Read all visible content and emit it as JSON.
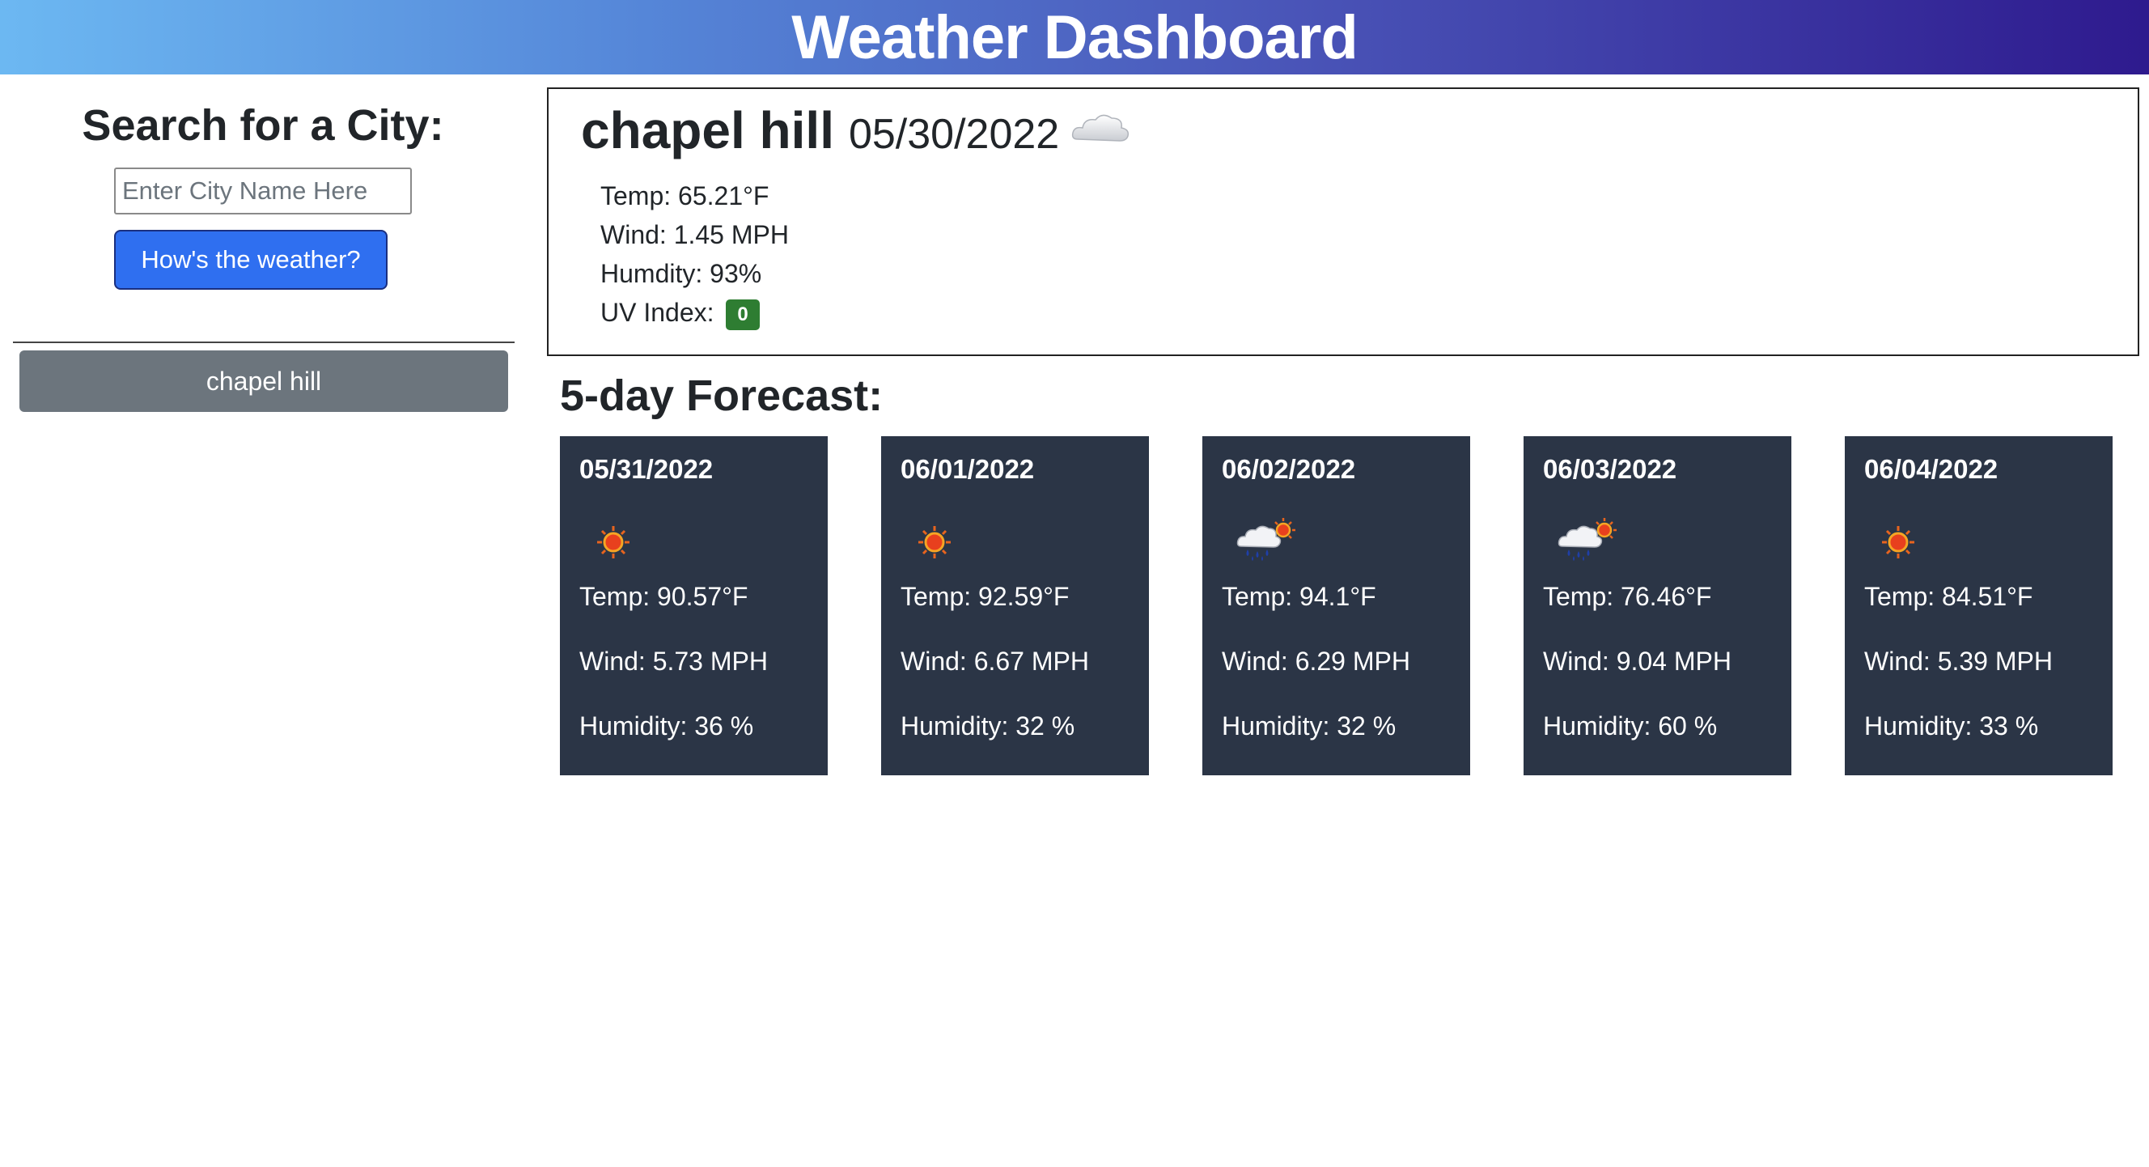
{
  "header": {
    "title": "Weather Dashboard"
  },
  "search": {
    "title": "Search for a City:",
    "placeholder": "Enter City Name Here",
    "button_label": "How's the weather?"
  },
  "history": [
    {
      "label": "chapel hill"
    }
  ],
  "current": {
    "city": "chapel hill",
    "date": "05/30/2022",
    "icon": "cloud-icon",
    "temp": "Temp: 65.21°F",
    "wind": "Wind: 1.45 MPH",
    "humidity": "Humdity: 93%",
    "uv_label": "UV Index:",
    "uv_value": "0",
    "uv_color": "#2e7d32"
  },
  "forecast": {
    "title": "5-day Forecast:",
    "days": [
      {
        "date": "05/31/2022",
        "icon": "sun-icon",
        "temp": "Temp: 90.57°F",
        "wind": "Wind: 5.73 MPH",
        "humidity": "Humidity: 36 %"
      },
      {
        "date": "06/01/2022",
        "icon": "sun-icon",
        "temp": "Temp: 92.59°F",
        "wind": "Wind: 6.67 MPH",
        "humidity": "Humidity: 32 %"
      },
      {
        "date": "06/02/2022",
        "icon": "sun-rain-cloud-icon",
        "temp": "Temp: 94.1°F",
        "wind": "Wind: 6.29 MPH",
        "humidity": "Humidity: 32 %"
      },
      {
        "date": "06/03/2022",
        "icon": "sun-rain-cloud-icon",
        "temp": "Temp: 76.46°F",
        "wind": "Wind: 9.04 MPH",
        "humidity": "Humidity: 60 %"
      },
      {
        "date": "06/04/2022",
        "icon": "sun-icon",
        "temp": "Temp: 84.51°F",
        "wind": "Wind: 5.39 MPH",
        "humidity": "Humidity: 33 %"
      }
    ]
  },
  "colors": {
    "header_gradient": [
      "#6cb8f2",
      "#2e1a8e"
    ],
    "primary_button": "#2f6ff0",
    "history_button": "#6c757d",
    "forecast_card": "#2b3546"
  }
}
